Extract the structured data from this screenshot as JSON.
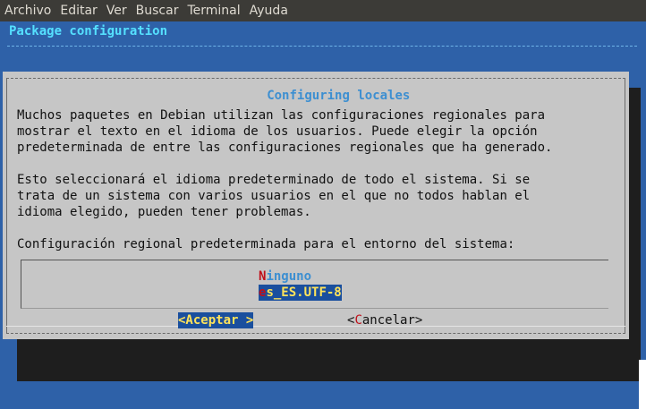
{
  "menubar": {
    "items": [
      "Archivo",
      "Editar",
      "Ver",
      "Buscar",
      "Terminal",
      "Ayuda"
    ]
  },
  "terminal": {
    "backtitle": "Package configuration"
  },
  "dialog": {
    "title": "Configuring locales",
    "paragraph1": [
      "Muchos paquetes en Debian utilizan las configuraciones regionales para",
      "mostrar el texto en el idioma de los usuarios. Puede elegir la opción",
      "predeterminada de entre las configuraciones regionales que ha generado."
    ],
    "paragraph2": [
      "Esto seleccionará el idioma predeterminado de todo el sistema. Si se",
      "trata de un sistema con varios usuarios en el que no todos hablan el",
      "idioma elegido, pueden tener problemas."
    ],
    "prompt": "Configuración regional predeterminada para el entorno del sistema:",
    "options": [
      {
        "hotkey": "N",
        "rest": "inguno",
        "selected": false
      },
      {
        "hotkey": "e",
        "rest": "s_ES.UTF-8",
        "selected": true
      }
    ],
    "buttons": {
      "accept": "<Aceptar >",
      "cancel_pre": "<",
      "cancel_hot": "C",
      "cancel_rest": "ancelar>"
    }
  },
  "colors": {
    "terminal_bg": "#2e61a8",
    "dialog_bg": "#c6c6c6",
    "highlight_bg": "#1a4f9e",
    "highlight_fg": "#ffe35a",
    "hotkey": "#c0101a",
    "title": "#3d8fd1"
  }
}
